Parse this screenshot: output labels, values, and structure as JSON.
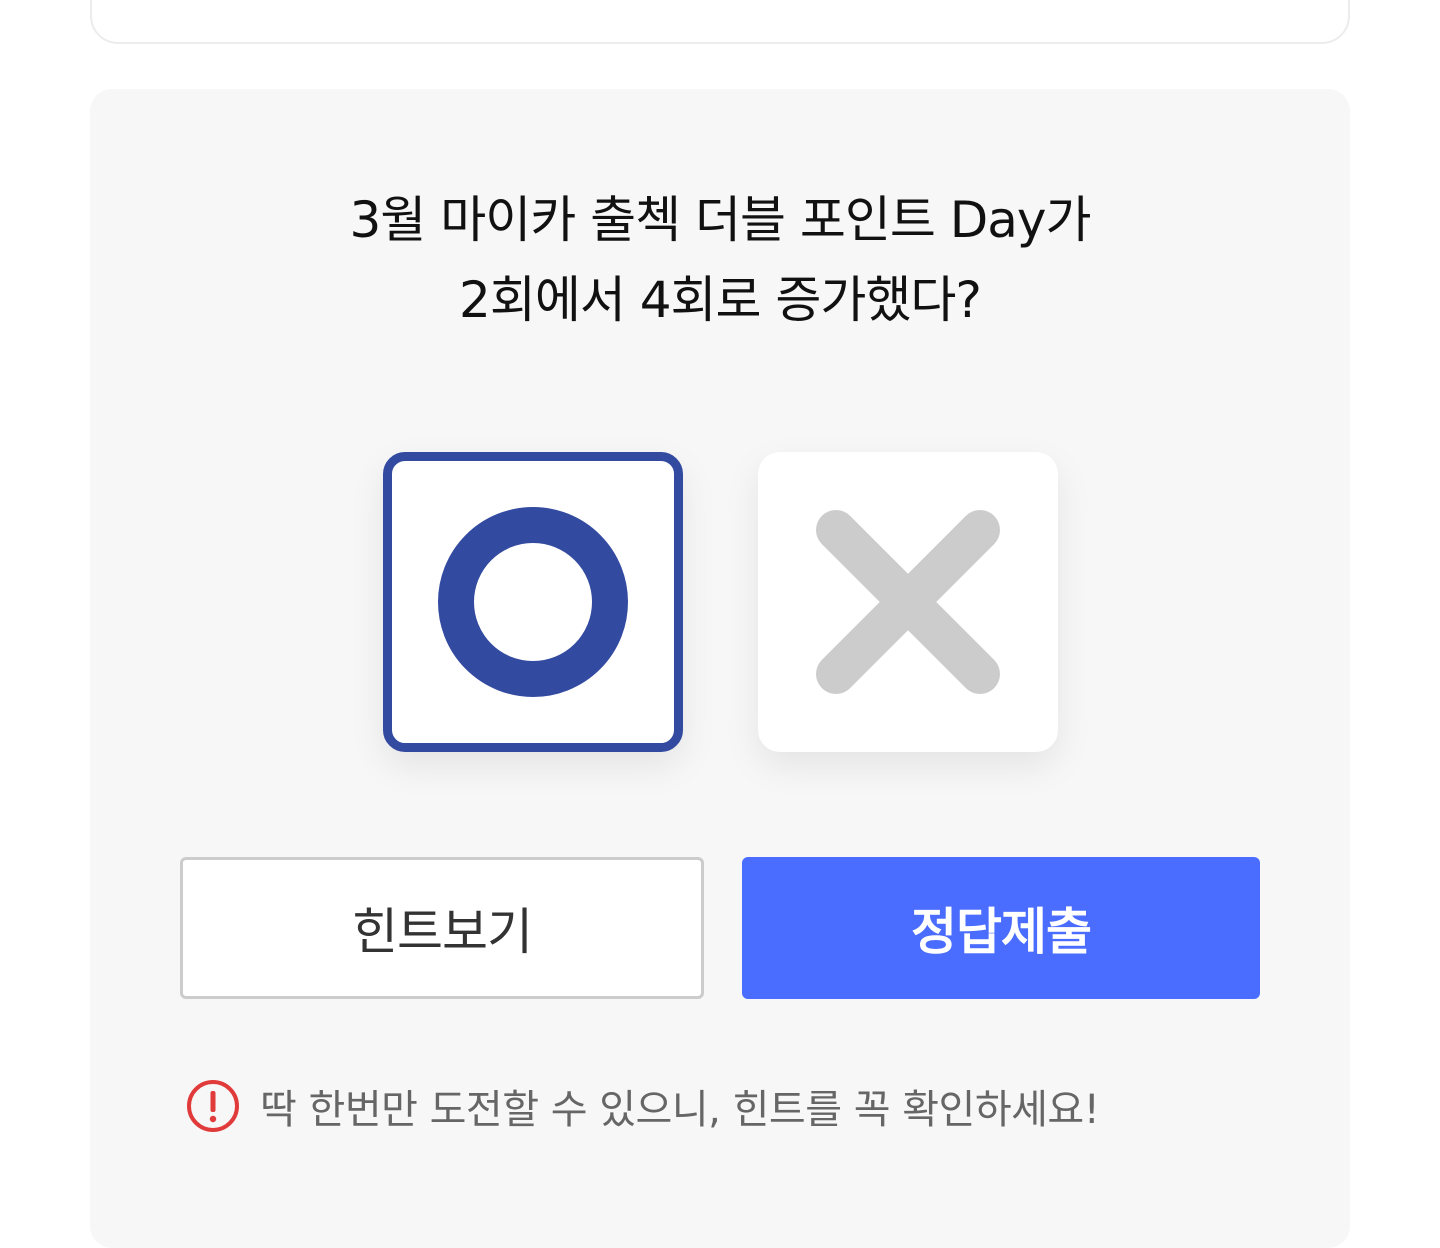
{
  "quiz": {
    "question_line1": "3월 마이카 출첵 더블 포인트 Day가",
    "question_line2": "2회에서 4회로 증가했다?",
    "choices": [
      {
        "label": "O",
        "icon": "circle-o-icon",
        "selected": true,
        "color": "#324aa0"
      },
      {
        "label": "X",
        "icon": "cross-x-icon",
        "selected": false,
        "color": "#cccccc"
      }
    ],
    "hint_button": "힌트보기",
    "submit_button": "정답제출",
    "notice_text": "딱 한번만 도전할 수 있으니, 힌트를 꼭 확인하세요!",
    "notice_icon": "exclamation-circle-icon"
  },
  "colors": {
    "accent": "#4a6dff",
    "selected_border": "#324aa0",
    "alert": "#e03a3a",
    "panel_bg": "#f7f7f7"
  }
}
